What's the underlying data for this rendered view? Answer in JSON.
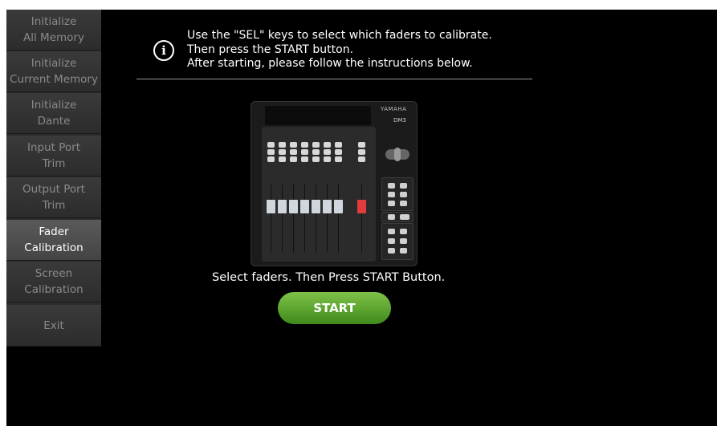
{
  "sidebar": {
    "items": [
      {
        "label": "Initialize\nAll Memory",
        "active": false
      },
      {
        "label": "Initialize\nCurrent Memory",
        "active": false
      },
      {
        "label": "Initialize\nDante",
        "active": false
      },
      {
        "label": "Input Port\nTrim",
        "active": false
      },
      {
        "label": "Output Port\nTrim",
        "active": false
      },
      {
        "label": "Fader\nCalibration",
        "active": true
      },
      {
        "label": "Screen\nCalibration",
        "active": false
      },
      {
        "label": "Exit",
        "active": false
      }
    ]
  },
  "main": {
    "info_icon": "info-icon",
    "instructions": [
      "Use the \"SEL\" keys to select which faders to calibrate.",
      "Then press the START button.",
      "After starting, please follow the instructions below."
    ],
    "device_image": {
      "brand": "YAMAHA",
      "model": "DM3"
    },
    "status_text": "Select faders. Then Press START Button.",
    "start_label": "START"
  },
  "colors": {
    "background": "#000000",
    "sidebar": "#2a2a2a",
    "sidebar_active": "#4d4d4d",
    "start_green": "#4e9a24",
    "selected_fader": "#e23b3b"
  }
}
